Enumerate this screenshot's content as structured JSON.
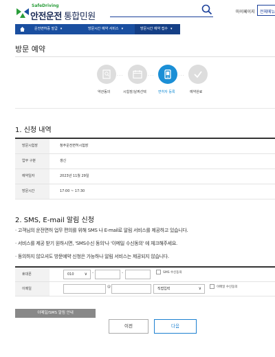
{
  "header": {
    "logo_small": "SafeDriving",
    "logo_main": "안전운전",
    "logo_sub": "통합민원",
    "mypage": "마이페이지",
    "allmenu": "전체메뉴"
  },
  "nav": {
    "items": [
      {
        "label": "운전면허증 발급",
        "caret": "▾"
      },
      {
        "label": "방문시간 예약 서비스",
        "caret": "▾"
      },
      {
        "label": "방문시간 예약 접수",
        "caret": "▾"
      }
    ]
  },
  "page_title": "방문 예약",
  "steps": [
    {
      "label": "약관동의"
    },
    {
      "label": "시험장/날짜선택"
    },
    {
      "label": "면허자 등록"
    },
    {
      "label": "예약완료"
    }
  ],
  "section1": {
    "title": "1. 신청 내역",
    "rows": [
      {
        "th": "방문시험장",
        "td": "청주운전면허시험장"
      },
      {
        "th": "업무 구분",
        "td": "갱신"
      },
      {
        "th": "예약일자",
        "td": "2023년 11월 29일"
      },
      {
        "th": "방문시간",
        "td": "17:00 ~ 17:30"
      }
    ]
  },
  "section2": {
    "title": "2. SMS, E-mail 알림 신청",
    "notices": [
      "· 고객님의 운전면허 업무 편의를 위해 SMS 나 E-mail로 알림 서비스를 제공하고 있습니다.",
      "· 서비스를 제공 받기 원하시면, 'SMS수신 동의'나 '이메일 수신동의' 에 체크해주세요.",
      "· 동의하지 않으셔도 방문예약 신청은 가능하나 알림 서비스는 제공되지 않습니다."
    ],
    "phone_label": "휴대폰",
    "phone_prefix": "010",
    "chevron": "∨",
    "phone_dash": "-",
    "sms_consent": "SMS 수신동의",
    "email_label": "이메일",
    "at_sign": "@",
    "email_domain": "직접입력",
    "email_consent": "이메일 수신동의"
  },
  "buttons": {
    "guide": "이메일/SMS 알림 안내",
    "prev": "이전",
    "next": "다음"
  }
}
